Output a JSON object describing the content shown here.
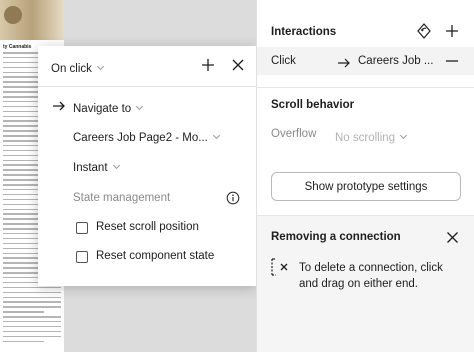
{
  "document": {
    "heading": "ty Cannabis"
  },
  "popup": {
    "trigger": "On click",
    "action": "Navigate to",
    "destination": "Careers Job Page2 - Mo...",
    "animation": "Instant",
    "state_management_label": "State management",
    "checkbox_scroll_label": "Reset scroll position",
    "checkbox_component_label": "Reset component state"
  },
  "panel": {
    "interactions_title": "Interactions",
    "trigger_label": "Click",
    "destination": "Careers Job ...",
    "scroll_behavior_title": "Scroll behavior",
    "overflow_label": "Overflow",
    "overflow_value": "No scrolling",
    "prototype_button": "Show prototype settings",
    "removing_title": "Removing a connection",
    "removing_text": "To delete a connection, click and drag on either end."
  }
}
